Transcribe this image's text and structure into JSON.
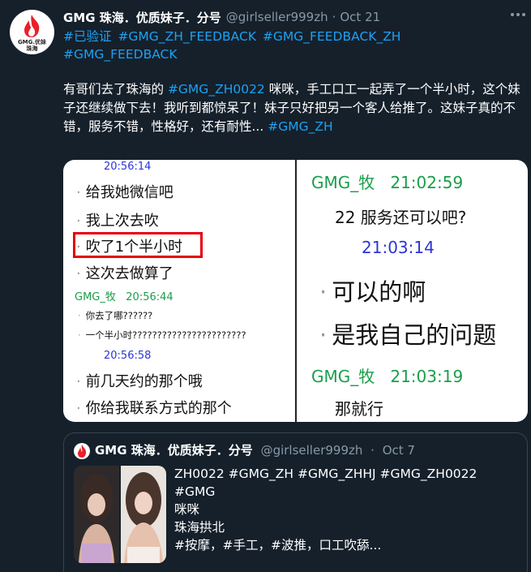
{
  "tweet": {
    "avatar": {
      "logo_text_1": "GMG.优妹",
      "logo_text_2": "珠海"
    },
    "author_name": "GMG 珠海．优质妹子．分号",
    "handle": "@girlseller999zh",
    "separator": "·",
    "date": "Oct 21",
    "hashtags": [
      "#已验证",
      "#GMG_ZH_FEEDBACK",
      "#GMG_FEEDBACK_ZH",
      "#GMG_FEEDBACK"
    ],
    "body": {
      "part1": "有哥们去了珠海的 ",
      "tag1": "#GMG_ZH0022",
      "part2": " 咪咪，手工口工一起弄了一个半小时，这个妹子还继续做下去！我听到都惊呆了！妹子只好把另一个客人给推了。这妹子真的不错，服务不错，性格好，还有耐性... ",
      "tag2": "#GMG_ZH"
    },
    "more_icon": "ellipsis-icon"
  },
  "chat_screenshot": {
    "left": {
      "ts1": "20:56:14",
      "m1": "给我她微信吧",
      "m2": "我上次去吹",
      "m3": "吹了1个半小时",
      "m4": "这次去做算了",
      "sender": "GMG_牧",
      "sender_ts": "20:56:44",
      "m5": "你去了哪??????",
      "m6": "一个半小时???????????????????????",
      "ts2": "20:56:58",
      "m7": "前几天约的那个哦",
      "m8": "你给我联系方式的那个"
    },
    "right": {
      "sender1": "GMG_牧",
      "sender1_ts": "21:02:59",
      "m1": "22 服务还可以吧?",
      "ts1": "21:03:14",
      "m2": "可以的啊",
      "m3": "是我自己的问题",
      "sender2": "GMG_牧",
      "sender2_ts": "21:03:19",
      "m4": "那就行"
    },
    "bullet": "·"
  },
  "quoted": {
    "author_name": "GMG 珠海．优质妹子．分号",
    "handle": "@girlseller999zh",
    "separator": "·",
    "date": "Oct 7",
    "lines": [
      "ZH0022 #GMG_ZH #GMG_ZHHJ #GMG_ZH0022",
      "#GMG",
      "咪咪",
      "珠海拱北",
      "#按摩，#手工，#波推，口工吹舔..."
    ]
  },
  "colors": {
    "background": "#15202b",
    "link": "#1da1f2",
    "muted": "#8899a6",
    "highlight_box": "#e6000c"
  }
}
